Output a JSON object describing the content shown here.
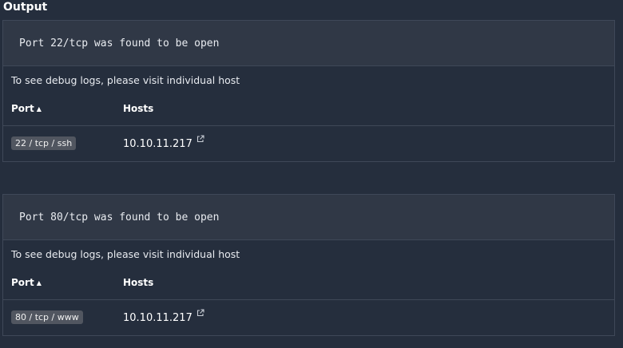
{
  "output": {
    "title": "Output",
    "findings": [
      {
        "message": "Port 22/tcp was found to be open",
        "debug_note": "To see debug logs, please visit individual host",
        "columns": {
          "port": "Port",
          "hosts": "Hosts"
        },
        "sort_icon": "triangle-up-icon",
        "row": {
          "port": "22 / tcp / ssh",
          "host": "10.10.11.217",
          "link_icon": "external-link-icon"
        }
      },
      {
        "message": "Port 80/tcp was found to be open",
        "debug_note": "To see debug logs, please visit individual host",
        "columns": {
          "port": "Port",
          "hosts": "Hosts"
        },
        "sort_icon": "triangle-up-icon",
        "row": {
          "port": "80 / tcp / www",
          "host": "10.10.11.217",
          "link_icon": "external-link-icon"
        }
      }
    ]
  },
  "colors": {
    "background": "#252e3d",
    "header_bg": "#303846",
    "border": "#3f4858",
    "badge_bg": "#515660"
  }
}
